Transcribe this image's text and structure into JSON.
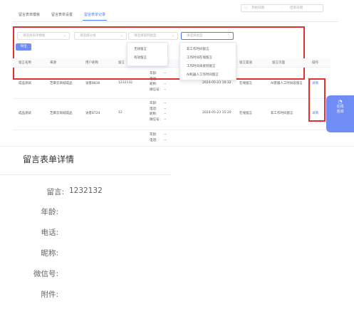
{
  "tabs": [
    {
      "label": "留言表单模板",
      "active": false
    },
    {
      "label": "留言表单设置",
      "active": false
    },
    {
      "label": "留言表单记录",
      "active": true
    }
  ],
  "filters": {
    "form_template": "请选择表单模板",
    "group": "请选择分组",
    "case_type": "请选择案例类型",
    "sub_type": "请选择类型",
    "date_start": "开始日期",
    "date_sep": "-",
    "date_end": "结束日期"
  },
  "export_label": "导出",
  "dropdown_valid": [
    "无效留言",
    "有效留言"
  ],
  "dropdown_source": [
    "非工作时间留言",
    "工作时间在线留言",
    "工作时间未接到留言",
    "AI机器人工作时间留言"
  ],
  "table": {
    "headers": [
      "留言名称",
      "来源",
      "用户昵称",
      "留言",
      "留言内容",
      "留言时间",
      "留言渠道",
      "留言页面",
      "操作"
    ],
    "rows": [
      {
        "name": "成品测试",
        "source": "芝麻云商城成品",
        "nickname": "访客8836",
        "message": "1232132",
        "details": [
          [
            "年龄:",
            "--"
          ],
          [
            "电话:",
            "--"
          ],
          [
            "昵称:",
            "--"
          ],
          [
            "微信号:",
            "--"
          ]
        ],
        "time": "2024-05-23 16:32",
        "channel": "在线留言",
        "page": "AI客服人工时间段留言",
        "op": "详情"
      },
      {
        "name": "成品测试",
        "source": "芝麻云商城成品",
        "nickname": "访客8724",
        "message": "12",
        "details": [
          [
            "年龄:",
            "--"
          ],
          [
            "电话:",
            "--"
          ],
          [
            "昵称:",
            "--"
          ],
          [
            "微信号:",
            "--"
          ]
        ],
        "time": "2024-05-23 15:20",
        "channel": "在线留言",
        "page": "非工作时间留言",
        "op": "详情"
      },
      {
        "details": [
          [
            "年龄:",
            "--"
          ],
          [
            "电话:",
            "--"
          ]
        ]
      }
    ]
  },
  "float_button": {
    "icon": "chat-icon",
    "lines": [
      "在线",
      "咨询"
    ]
  },
  "detail": {
    "title": "留言表单详情",
    "fields": [
      {
        "label": "留言:",
        "value": "1232132"
      },
      {
        "label": "年龄:",
        "value": ""
      },
      {
        "label": "电话:",
        "value": ""
      },
      {
        "label": "昵称:",
        "value": ""
      },
      {
        "label": "微信号:",
        "value": ""
      },
      {
        "label": "附件:",
        "value": ""
      }
    ]
  },
  "colors": {
    "accent": "#4a7cf7",
    "highlight": "#e03131",
    "button": "#6f8df5"
  }
}
